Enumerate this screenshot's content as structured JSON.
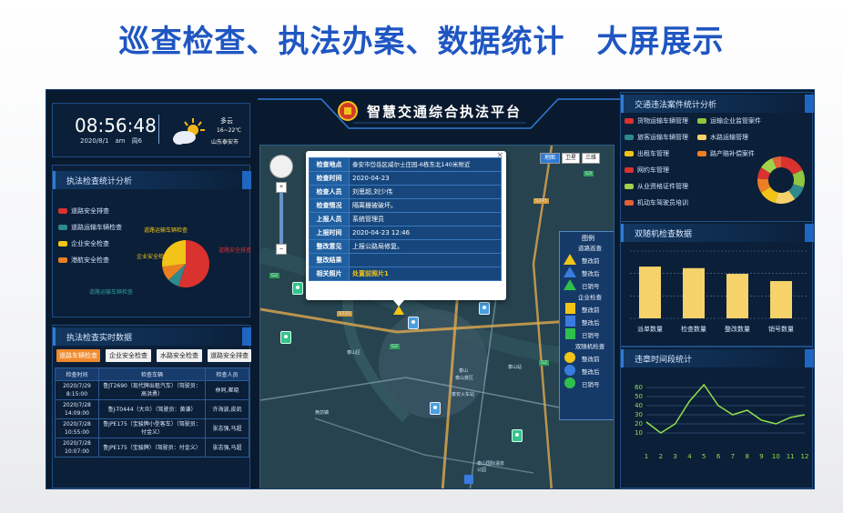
{
  "banner_title": "巡查检查、执法办案、数据统计　大屏展示",
  "platform_title": "智慧交通综合执法平台",
  "clock": {
    "time": "08:56:48",
    "date": "2020/8/1　am　周6"
  },
  "weather": {
    "desc": "多云",
    "temp": "16~22℃",
    "location": "山东泰安市",
    "icon": "partly-cloudy-icon"
  },
  "left_stats": {
    "title": "执法检查统计分析",
    "legend": [
      {
        "label": "道路安全排查",
        "color": "#d9322f"
      },
      {
        "label": "道路运输车辆检查",
        "color": "#2e8a8c"
      },
      {
        "label": "企业安全检查",
        "color": "#f2c417"
      },
      {
        "label": "港航安全检查",
        "color": "#ec7f22"
      }
    ],
    "pie_labels": [
      "道路运输车辆检查",
      "企业安全检查",
      "道路安全排查",
      "道路运输车辆检查"
    ],
    "pie_values": [
      0.55,
      0.08,
      0.1,
      0.27
    ]
  },
  "realtime": {
    "title": "执法检查实时数据",
    "tabs": [
      "道路车辆检查",
      "企业安全检查",
      "水路安全检查",
      "道路安全排查"
    ],
    "active_tab": 0,
    "columns": [
      "检查时间",
      "检查车辆",
      "检查人员"
    ],
    "rows": [
      [
        "2020/7/29 8:15:00",
        "鲁JT2690（现代牌出租汽车）（驾驶员：高洪勇）",
        "林同,崔晓"
      ],
      [
        "2020/7/28 14:09:00",
        "鲁J-T0444（大众）（驾驶员：黄谦）",
        "许海波,皮凯"
      ],
      [
        "2020/7/28 10:55:00",
        "鲁JPE175（宝骏牌小型客车）（驾驶员：付金义）",
        "张志强,马超"
      ],
      [
        "2020/7/28 10:07:00",
        "鲁JPE175（宝骏牌）（驾驶员：付金义）",
        "张志强,马超"
      ]
    ]
  },
  "map": {
    "type_buttons": [
      "地图",
      "卫星",
      "三维"
    ],
    "popup": [
      {
        "k": "检查地点",
        "v": "泰安市岱岳区威尔士庄园-6栋东北140米附近"
      },
      {
        "k": "检查时间",
        "v": "2020-04-23"
      },
      {
        "k": "检查人员",
        "v": "刘思超,刘少伟"
      },
      {
        "k": "检查情况",
        "v": "隔离栅被破坏。"
      },
      {
        "k": "上报人员",
        "v": "系统管理员"
      },
      {
        "k": "上报时间",
        "v": "2020-04-23 12:46"
      },
      {
        "k": "整改意见",
        "v": "上报公路局修复。"
      },
      {
        "k": "整改结果",
        "v": ""
      },
      {
        "k": "相关照片",
        "v": "处置前照片1"
      }
    ],
    "legend": {
      "title": "图例",
      "groups": [
        {
          "name": "道路巡查",
          "items": [
            {
              "label": "整改前",
              "sym": "triangle",
              "color": "#f2c417"
            },
            {
              "label": "整改后",
              "sym": "triangle",
              "color": "#3a7be0"
            },
            {
              "label": "已销号",
              "sym": "triangle",
              "color": "#2fbf4b"
            }
          ]
        },
        {
          "name": "企业检查",
          "items": [
            {
              "label": "整改前",
              "sym": "square",
              "color": "#f2c417"
            },
            {
              "label": "整改后",
              "sym": "square",
              "color": "#3a7be0"
            },
            {
              "label": "已销号",
              "sym": "square",
              "color": "#2fbf4b"
            }
          ]
        },
        {
          "name": "双随机检查",
          "items": [
            {
              "label": "整改前",
              "sym": "circle",
              "color": "#f2c417"
            },
            {
              "label": "整改后",
              "sym": "circle",
              "color": "#3a7be0"
            },
            {
              "label": "已销号",
              "sym": "circle",
              "color": "#2fbf4b"
            }
          ]
        }
      ]
    },
    "road_labels": [
      "G3",
      "G2",
      "S243",
      "G2",
      "S333",
      "G2",
      "泰山景区",
      "泰山",
      "泰山站",
      "泰安火车站",
      "泰山区",
      "泰山国际温泉公园",
      "黄前镇"
    ]
  },
  "right_cases": {
    "title": "交通违法案件统计分析",
    "legend": [
      {
        "label": "货物运输车辆管理",
        "color": "#d9322f"
      },
      {
        "label": "运输企业监管案件",
        "color": "#8fc63f"
      },
      {
        "label": "旅客运输车辆管理",
        "color": "#2e8a8c"
      },
      {
        "label": "水路运输管理",
        "color": "#f5d26a"
      },
      {
        "label": "出租车管理",
        "color": "#f2c417"
      },
      {
        "label": "路产赔补偿案件",
        "color": "#ec7f22"
      },
      {
        "label": "网约车管理",
        "color": "#d9322f"
      },
      {
        "label": "从业资格证件管理",
        "color": "#a3d04a"
      },
      {
        "label": "机动车驾驶员培训",
        "color": "#e2613b"
      }
    ],
    "donut_values": [
      0.18,
      0.12,
      0.1,
      0.14,
      0.12,
      0.1,
      0.08,
      0.1,
      0.06
    ]
  },
  "chart_data": [
    {
      "type": "bar",
      "title": "双随机检查数据",
      "categories": [
        "派单数量",
        "检查数量",
        "整改数量",
        "销号数量"
      ],
      "values": [
        100,
        97,
        86,
        72
      ],
      "ylim": [
        0,
        130
      ],
      "color": "#f5d26a"
    },
    {
      "type": "line",
      "title": "违章时间段统计",
      "x": [
        1,
        2,
        3,
        4,
        5,
        6,
        7,
        8,
        9,
        10,
        11,
        12
      ],
      "y": [
        22,
        10,
        20,
        45,
        63,
        40,
        30,
        35,
        24,
        20,
        27,
        30
      ],
      "ylim": [
        0,
        70
      ],
      "yticks": [
        10,
        20,
        30,
        40,
        50,
        60
      ],
      "color": "#8fe04a"
    }
  ]
}
